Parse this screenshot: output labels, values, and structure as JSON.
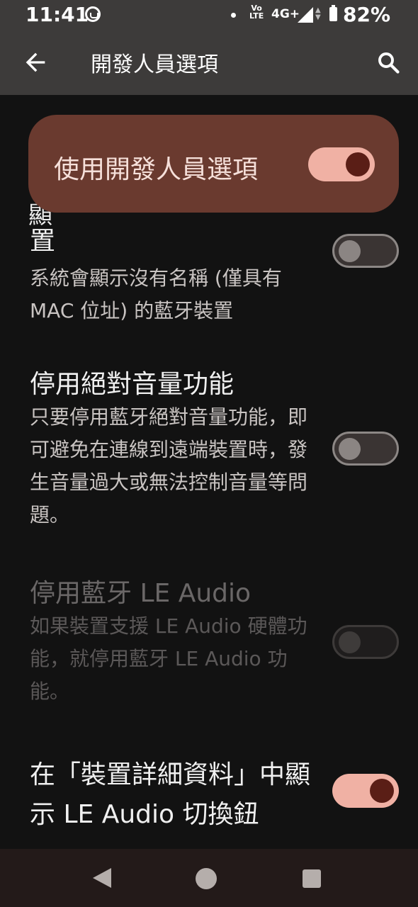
{
  "status_bar": {
    "time": "11:41",
    "volte_top": "Vo",
    "volte_bottom": "LTE",
    "network": "4G+",
    "battery_percent": "82%"
  },
  "app_bar": {
    "title": "開發人員選項",
    "back_icon": "arrow-left-icon",
    "search_icon": "search-icon"
  },
  "master_switch": {
    "label": "使用開發人員選項",
    "on": true
  },
  "partial_item_title_fragment": "顯",
  "items": [
    {
      "title": "置",
      "summary": "系統會顯示沒有名稱 (僅具有 MAC 位址) 的藍牙裝置",
      "on": false,
      "enabled": true
    },
    {
      "title": "停用絕對音量功能",
      "summary": "只要停用藍牙絕對音量功能，即可避免在連線到遠端裝置時，發生音量過大或無法控制音量等問題。",
      "on": false,
      "enabled": true
    },
    {
      "title": "停用藍牙 LE Audio",
      "summary": "如果裝置支援 LE Audio 硬體功能，就停用藍牙 LE Audio 功能。",
      "on": false,
      "enabled": false
    },
    {
      "title": "在「裝置詳細資料」中顯示 LE Audio 切換鈕",
      "summary": "",
      "on": true,
      "enabled": true
    }
  ],
  "nav_bar": {
    "back_icon": "nav-back-icon",
    "home_icon": "nav-home-icon",
    "recents_icon": "nav-recents-icon"
  },
  "colors": {
    "app_bar": "#3d3b3a",
    "master_card": "#6a3a2f",
    "switch_on_track": "#f0b1a4",
    "switch_on_knob": "#5a1e16",
    "background": "#121212"
  }
}
